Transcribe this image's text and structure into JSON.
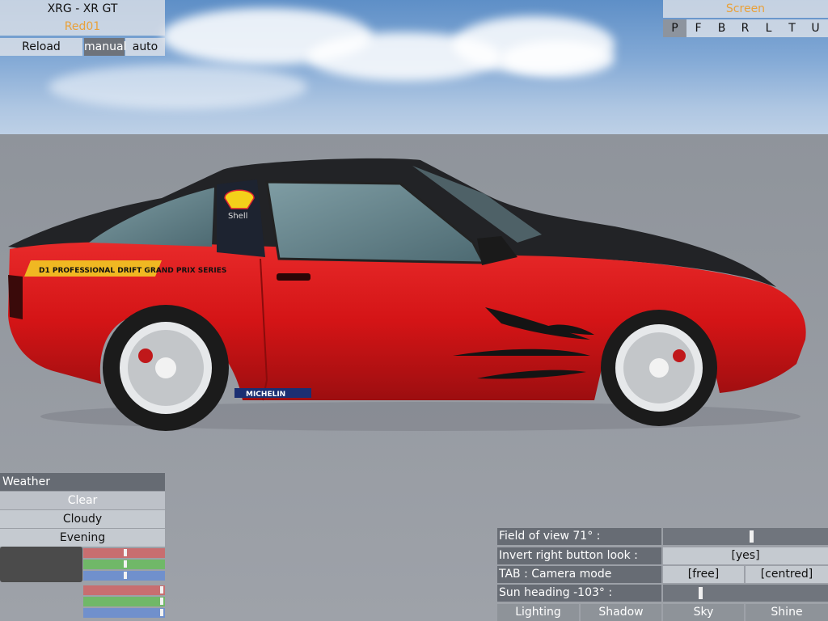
{
  "car_panel": {
    "title": "XRG - XR GT",
    "skin": "Red01",
    "reload_label": "Reload",
    "manual_label": "manual",
    "auto_label": "auto"
  },
  "screen_panel": {
    "title": "Screen",
    "view_buttons": [
      "P",
      "F",
      "B",
      "R",
      "L",
      "T",
      "U"
    ],
    "selected_view": "P"
  },
  "weather": {
    "header": "Weather",
    "options": [
      "Clear",
      "Cloudy",
      "Evening"
    ],
    "selected": "Clear",
    "sliders": [
      {
        "color": "#c86e70",
        "level": 0.52
      },
      {
        "color": "#70b868",
        "level": 0.52
      },
      {
        "color": "#7090cc",
        "level": 0.52
      },
      {
        "color": "#c86e70",
        "level": 0.98
      },
      {
        "color": "#70b868",
        "level": 0.98
      },
      {
        "color": "#7090cc",
        "level": 0.98
      }
    ]
  },
  "view_options": {
    "fov_label": "Field of view 71° :",
    "fov_level": 0.54,
    "invert_label": "Invert right button look :",
    "invert_value": "[yes]",
    "camera_label": "TAB : Camera mode",
    "camera_free": "[free]",
    "camera_centred": "[centred]",
    "sun_label": "Sun heading -103° :",
    "sun_level": 0.22,
    "tabs": [
      "Lighting",
      "Shadow",
      "Sky",
      "Shine"
    ]
  },
  "decals": {
    "hood_sponsor": "Shell",
    "series_sticker": "D1 PROFESSIONAL DRIFT GRAND PRIX SERIES",
    "tyre_sponsor": "MICHELIN"
  },
  "colors": {
    "orange_accent": "#e9a13a",
    "cyan_accent": "#36bde8",
    "car_red": "#d41416",
    "car_roof": "#222326"
  }
}
